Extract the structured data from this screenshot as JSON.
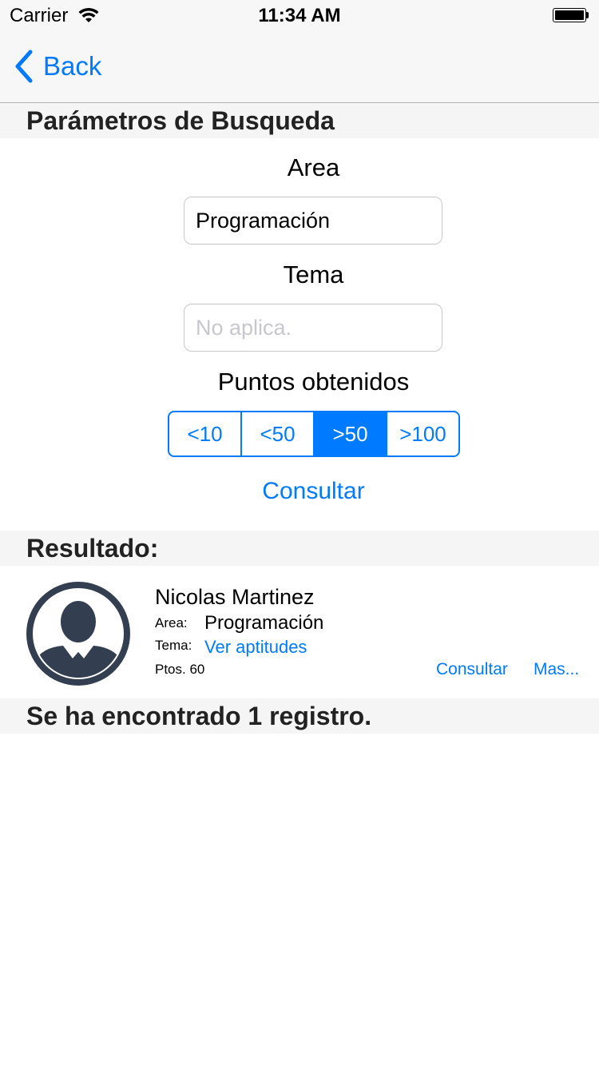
{
  "status_bar": {
    "carrier": "Carrier",
    "time": "11:34 AM"
  },
  "nav": {
    "back_label": "Back"
  },
  "search_section": {
    "header": "Parámetros de Busqueda",
    "area_label": "Area",
    "area_value": "Programación",
    "tema_label": "Tema",
    "tema_placeholder": "No aplica.",
    "puntos_label": "Puntos obtenidos",
    "segments": [
      "<10",
      "<50",
      ">50",
      ">100"
    ],
    "selected_segment": ">50",
    "consultar_label": "Consultar"
  },
  "results_section": {
    "header": "Resultado:",
    "items": [
      {
        "name": "Nicolas Martinez",
        "area_label": "Area:",
        "area_value": "Programación",
        "tema_label": "Tema:",
        "tema_link": "Ver aptitudes",
        "points": "Ptos. 60",
        "consultar_label": "Consultar",
        "mas_label": "Mas..."
      }
    ],
    "summary": "Se ha encontrado 1 registro."
  },
  "colors": {
    "accent": "#007aff",
    "avatar": "#333f50",
    "section_bg": "#f5f5f5"
  },
  "icons": {
    "back": "chevron-left-icon",
    "avatar": "user-avatar-icon",
    "wifi": "wifi-icon",
    "battery": "battery-icon"
  }
}
